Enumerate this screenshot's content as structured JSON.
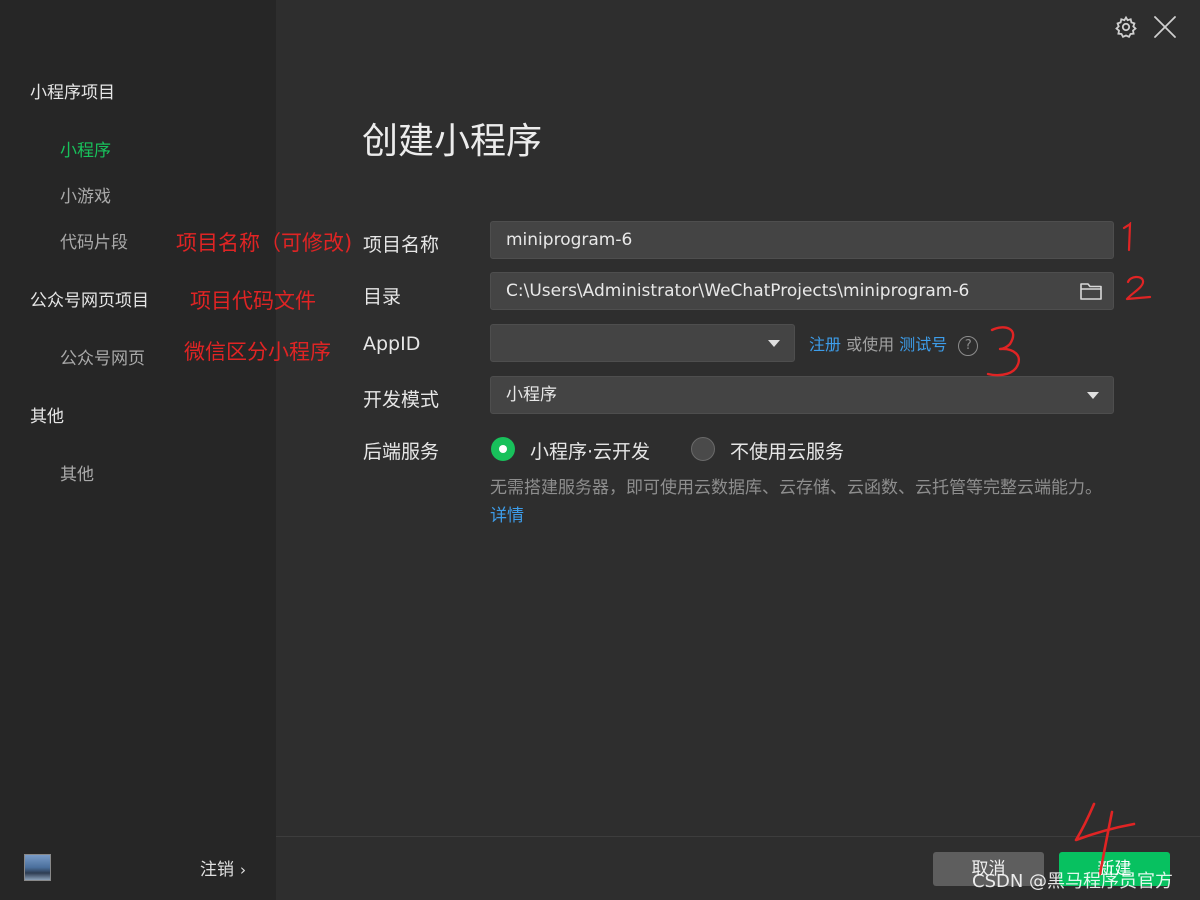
{
  "sidebar": {
    "sections": [
      {
        "title": "小程序项目",
        "items": [
          "小程序",
          "小游戏",
          "代码片段"
        ]
      },
      {
        "title": "公众号网页项目",
        "items": [
          "公众号网页"
        ]
      },
      {
        "title": "其他",
        "items": [
          "其他"
        ]
      }
    ],
    "active_item": "小程序",
    "logout_label": "注销",
    "logout_chevron": "›"
  },
  "window_icons": [
    "gear-icon",
    "close-icon"
  ],
  "main": {
    "title": "创建小程序",
    "fields": {
      "project_name": {
        "label": "项目名称",
        "value": "miniprogram-6"
      },
      "directory": {
        "label": "目录",
        "value": "C:\\Users\\Administrator\\WeChatProjects\\miniprogram-6"
      },
      "appid": {
        "label": "AppID",
        "value": "",
        "register_link": "注册",
        "or_use": "或使用",
        "test_link": "测试号",
        "help": "?"
      },
      "dev_mode": {
        "label": "开发模式",
        "value": "小程序"
      },
      "backend": {
        "label": "后端服务",
        "options": [
          "小程序·云开发",
          "不使用云服务"
        ],
        "selected": "小程序·云开发",
        "description": "无需搭建服务器，即可使用云数据库、云存储、云函数、云托管等完整云端能力。",
        "details_link": "详情"
      }
    }
  },
  "footer": {
    "cancel_label": "取消",
    "create_label": "新建"
  },
  "annotations": {
    "name_note": "项目名称（可修改)",
    "dir_note": "项目代码文件",
    "appid_note": "微信区分小程序",
    "numbers": [
      "1",
      "2",
      "3",
      "4"
    ]
  },
  "watermark": "CSDN @黑马程序员官方",
  "colors": {
    "accent_green": "#07c160",
    "link_blue": "#3d9dea",
    "annotation_red": "#e02424",
    "sidebar_bg": "#262626",
    "main_bg": "#2e2e2e"
  }
}
